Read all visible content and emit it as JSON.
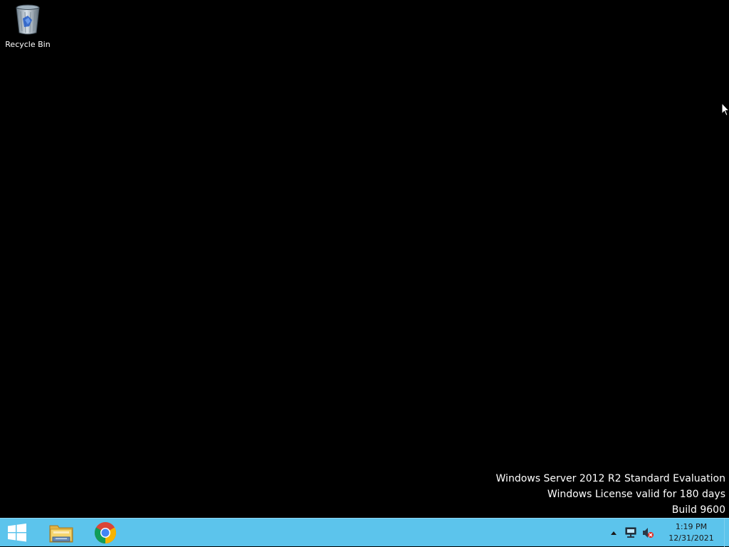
{
  "desktop": {
    "background_color": "#000000",
    "icons": [
      {
        "label": "Recycle Bin",
        "icon": "recycle-bin-icon"
      }
    ],
    "watermark": {
      "line1": "Windows Server 2012 R2 Standard Evaluation",
      "line2": "Windows License valid for 180 days",
      "line3": "Build 9600"
    }
  },
  "taskbar": {
    "color": "#5cc4ec",
    "start_icon": "windows-logo-icon",
    "pinned": [
      {
        "name": "File Explorer",
        "icon": "file-explorer-icon"
      },
      {
        "name": "Google Chrome",
        "icon": "chrome-icon"
      }
    ],
    "tray": {
      "icons": [
        "show-hidden-icons-arrow",
        "network-icon",
        "volume-muted-icon"
      ],
      "time": "1:19 PM",
      "date": "12/31/2021"
    }
  }
}
